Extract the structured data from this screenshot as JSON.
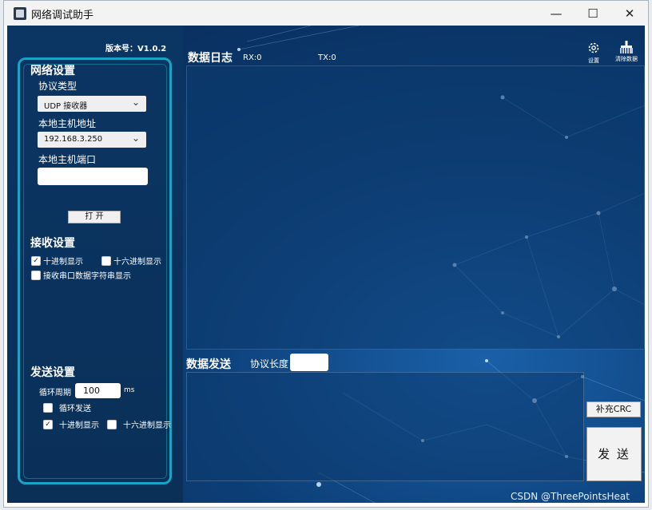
{
  "window": {
    "title": "网络调试助手",
    "min_glyph": "—",
    "max_glyph": "☐",
    "close_glyph": "✕"
  },
  "sidebar": {
    "version": "版本号：V1.0.2",
    "network": {
      "title": "网络设置",
      "protocol_label": "协议类型",
      "protocol_value": "UDP  接收器",
      "host_label": "本地主机地址",
      "host_value": "192.168.3.250",
      "port_label": "本地主机端口",
      "port_value": "",
      "open_button": "打 开"
    },
    "receive": {
      "title": "接收设置",
      "decimal": {
        "label": "十进制显示",
        "checked": true
      },
      "hex": {
        "label": "十六进制显示",
        "checked": false
      },
      "string": {
        "label": "接收串口数据字符串显示",
        "checked": false
      }
    },
    "send": {
      "title": "发送设置",
      "period_label": "循环周期",
      "period_value": "100",
      "period_unit": "ms",
      "loop": {
        "label": "循环发送",
        "checked": false
      },
      "decimal": {
        "label": "十进制显示",
        "checked": true
      },
      "hex": {
        "label": "十六进制显示",
        "checked": false
      }
    }
  },
  "log": {
    "title": "数据日志",
    "rx": "RX:0",
    "tx": "TX:0",
    "settings_label": "设置",
    "clear_label": "清除数据"
  },
  "sender": {
    "title": "数据发送",
    "length_label": "协议长度",
    "length_value": "",
    "crc_button": "补充CRC",
    "send_button": "发 送"
  },
  "watermark": "CSDN @ThreePointsHeat",
  "colors": {
    "accent": "#1aa3c7",
    "panel": "#0b3563"
  }
}
